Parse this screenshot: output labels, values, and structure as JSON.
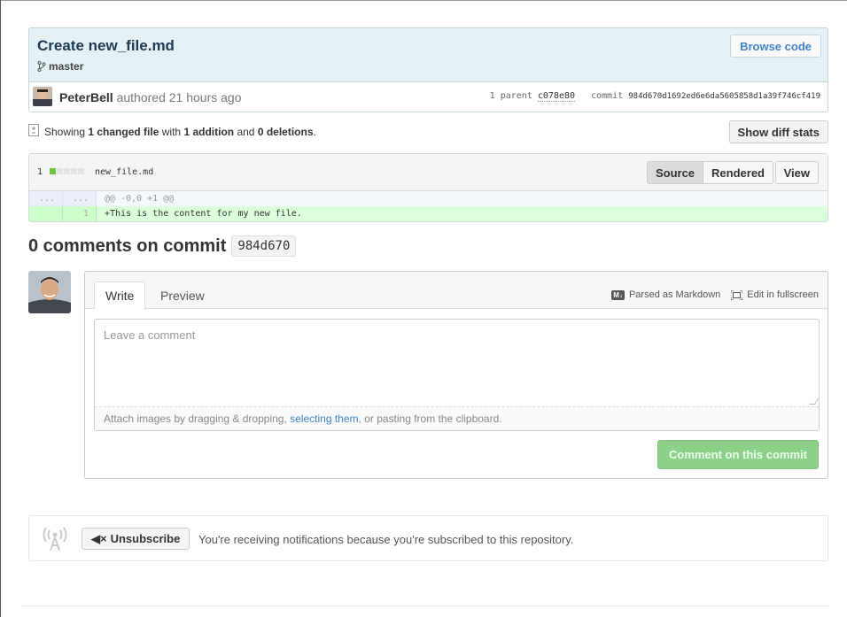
{
  "commit": {
    "title": "Create new_file.md",
    "branch": "master",
    "browse_label": "Browse code",
    "author": "PeterBell",
    "authored_text": "authored 21 hours ago",
    "parent_count_label": "1 parent",
    "parent_sha": "c078e80",
    "commit_label": "commit",
    "full_sha": "984d670d1692ed6e6da5605858d1a39f746cf419"
  },
  "toc": {
    "prefix": "Showing",
    "changed": "1 changed file",
    "with": "with",
    "additions": "1 addition",
    "and": "and",
    "deletions": "0 deletions",
    "suffix": ".",
    "diffstat_button": "Show diff stats"
  },
  "file": {
    "count": "1",
    "name": "new_file.md",
    "view_source": "Source",
    "view_rendered": "Rendered",
    "view_button": "View",
    "diffstat_colors": [
      "#6cc644",
      "#e4e4e4",
      "#e4e4e4",
      "#e4e4e4",
      "#e4e4e4"
    ],
    "lines": [
      {
        "old": "...",
        "new": "...",
        "code": "@@ -0,0 +1 @@",
        "kind": "hunk"
      },
      {
        "old": "",
        "new": "1",
        "code": "+This is the content for my new file.",
        "kind": "add"
      }
    ]
  },
  "comments": {
    "heading": "0 comments on commit",
    "short_sha": "984d670"
  },
  "form": {
    "tab_write": "Write",
    "tab_preview": "Preview",
    "md_badge": "M↓",
    "markdown_label": "Parsed as Markdown",
    "fullscreen_label": "Edit in fullscreen",
    "placeholder": "Leave a comment",
    "attach_before": "Attach images by dragging & dropping,",
    "attach_link": "selecting them",
    "attach_after": ", or pasting from the clipboard.",
    "submit_label": "Comment on this commit"
  },
  "subscription": {
    "button_label": "Unsubscribe",
    "button_glyph": "◀×",
    "reason": "You're receiving notifications because you're subscribed to this repository."
  },
  "colors": {
    "accent_link": "#4183c4",
    "addition_green": "#dbffdb",
    "submit_green": "#8dd08a"
  }
}
